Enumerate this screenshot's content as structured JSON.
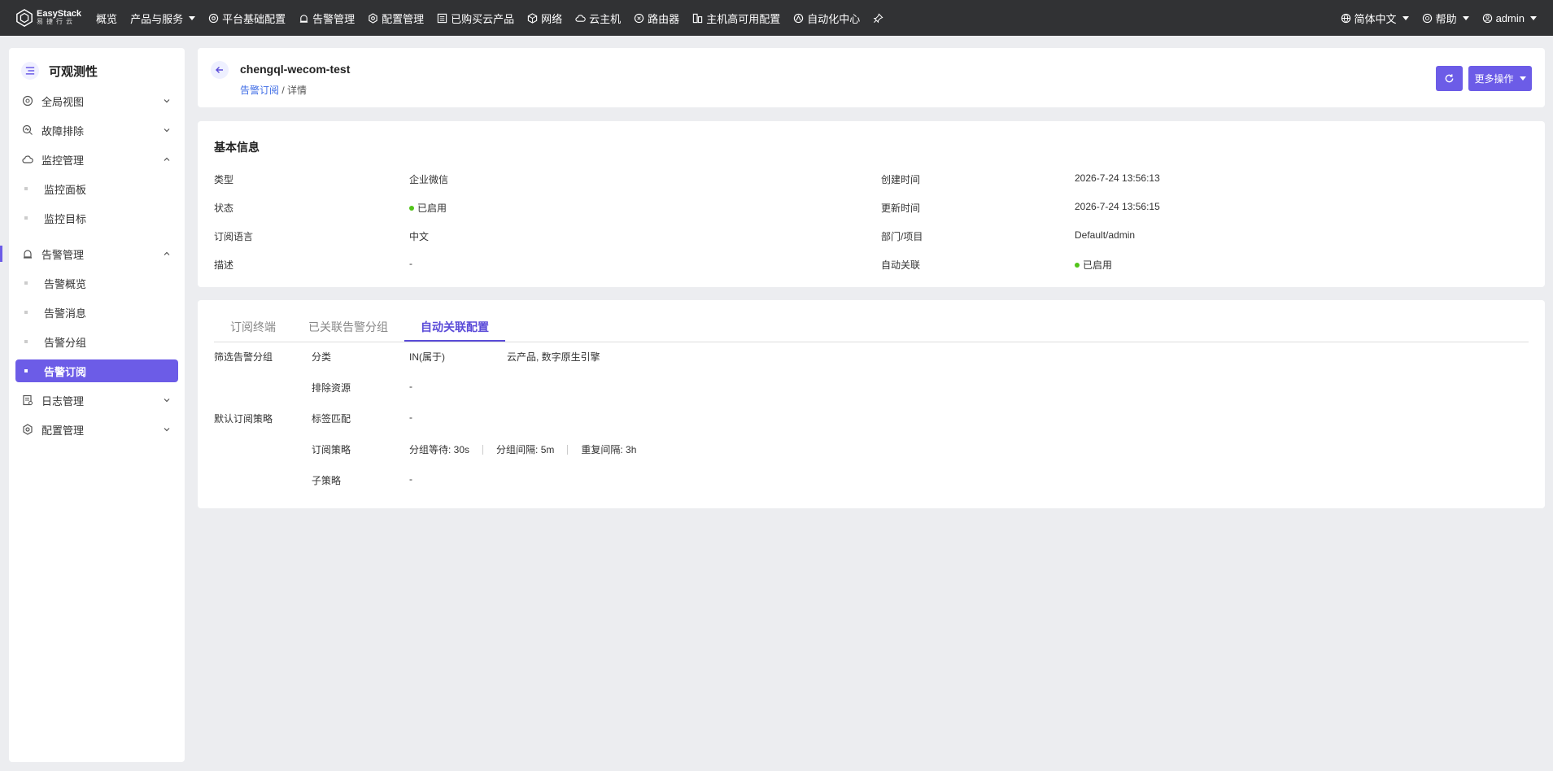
{
  "brand": {
    "name_en": "EasyStack",
    "name_cn": "易捷行云"
  },
  "topnav": {
    "items": [
      {
        "label": "概览"
      },
      {
        "label": "产品与服务"
      },
      {
        "label": "平台基础配置"
      },
      {
        "label": "告警管理"
      },
      {
        "label": "配置管理"
      },
      {
        "label": "已购买云产品"
      },
      {
        "label": "网络"
      },
      {
        "label": "云主机"
      },
      {
        "label": "路由器"
      },
      {
        "label": "主机高可用配置"
      },
      {
        "label": "自动化中心"
      }
    ],
    "language": "简体中文",
    "help": "帮助",
    "user": "admin"
  },
  "sidebar": {
    "title": "可观测性",
    "groups": [
      {
        "label": "全局视图"
      },
      {
        "label": "故障排除"
      },
      {
        "label": "监控管理",
        "children": [
          "监控面板",
          "监控目标"
        ]
      },
      {
        "label": "告警管理",
        "children": [
          "告警概览",
          "告警消息",
          "告警分组",
          "告警订阅"
        ]
      },
      {
        "label": "日志管理"
      },
      {
        "label": "配置管理"
      }
    ]
  },
  "header": {
    "title": "chengql-wecom-test",
    "breadcrumb_link": "告警订阅",
    "breadcrumb_sep": "/",
    "breadcrumb_current": "详情",
    "more_actions": "更多操作"
  },
  "basic_info": {
    "title": "基本信息",
    "left": [
      {
        "label": "类型",
        "value": "企业微信"
      },
      {
        "label": "状态",
        "value": "已启用"
      },
      {
        "label": "订阅语言",
        "value": "中文"
      },
      {
        "label": "描述",
        "value": "-"
      }
    ],
    "right": [
      {
        "label": "创建时间",
        "value": "2026-7-24 13:56:13"
      },
      {
        "label": "更新时间",
        "value": "2026-7-24 13:56:15"
      },
      {
        "label": "部门/项目",
        "value": "Default/admin"
      },
      {
        "label": "自动关联",
        "value": "已启用"
      }
    ]
  },
  "tabs": {
    "items": [
      "订阅终端",
      "已关联告警分组",
      "自动关联配置"
    ],
    "active": 2
  },
  "auto_config": {
    "filter_group_label": "筛选告警分组",
    "default_policy_label": "默认订阅策略",
    "rows": [
      {
        "label": "分类",
        "op": "IN(属于)",
        "value": "云产品, 数字原生引擎"
      },
      {
        "label": "排除资源",
        "value": "-"
      },
      {
        "label": "标签匹配",
        "value": "-"
      },
      {
        "label": "订阅策略",
        "policies": [
          "分组等待: 30s",
          "分组间隔: 5m",
          "重复间隔: 3h"
        ]
      },
      {
        "label": "子策略",
        "value": "-"
      }
    ]
  },
  "colors": {
    "accent": "#6c5ce7",
    "topbar": "#313234",
    "link": "#3d6be5",
    "enabled": "#52c41a"
  }
}
